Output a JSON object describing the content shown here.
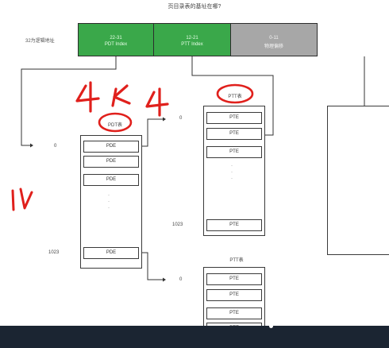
{
  "title": "页目录表的基址在哪?",
  "address": {
    "label": "32为逻辑地址",
    "segments": [
      {
        "range": "22-31",
        "name": "PDT Index"
      },
      {
        "range": "12-21",
        "name": "PTT Index"
      },
      {
        "range": "0-11",
        "name": "物理偏移"
      }
    ]
  },
  "pdt": {
    "caption": "PDT表",
    "first_index": "0",
    "last_index": "1023",
    "entries": [
      "PDE",
      "PDE",
      "PDE",
      "PDE"
    ],
    "dots": [
      "·",
      "·",
      "·"
    ]
  },
  "ptt1": {
    "caption": "PTT表",
    "first_index": "0",
    "last_index": "1023",
    "entries": [
      "PTE",
      "PTE",
      "PTE",
      "PTE"
    ],
    "dots": [
      "·",
      "·",
      "·"
    ]
  },
  "ptt2": {
    "caption": "PTT表",
    "first_index": "0",
    "entries": [
      "PTE",
      "PTE",
      "PTE",
      "PTE"
    ]
  },
  "handwriting": {
    "note_4k4": "4K 4",
    "note_10": "10",
    "ink_color": "#e0201c"
  },
  "colors": {
    "green": "#3aa84a",
    "gray": "#a7a7a7",
    "bottom_bar": "#1b2532"
  }
}
